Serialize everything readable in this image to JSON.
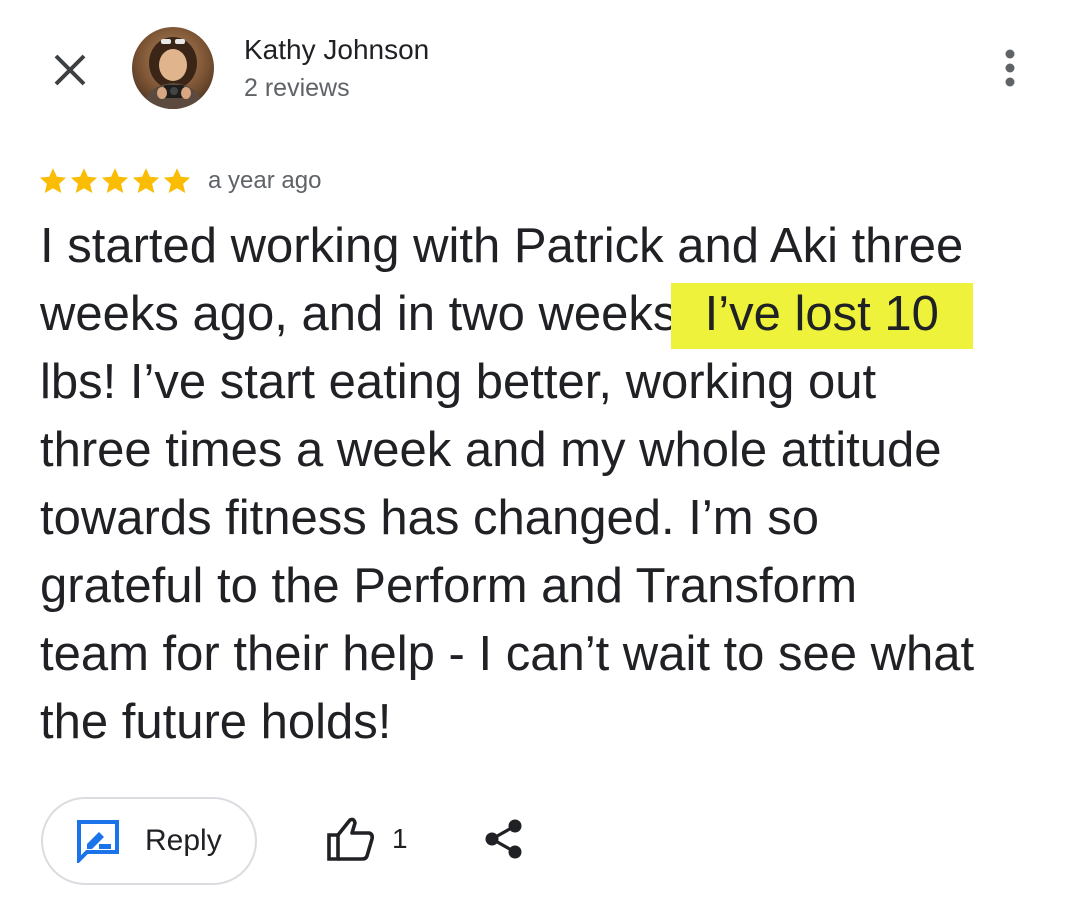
{
  "header": {
    "close_icon": "close-icon",
    "author_name": "Kathy Johnson",
    "author_reviews": "2 reviews",
    "more_icon": "more-vert-icon"
  },
  "review": {
    "stars": 5,
    "max_stars": 5,
    "star_color": "#fbbc04",
    "date": "a year ago",
    "lines": [
      "I started working with Patrick and Aki three",
      "weeks ago, and in two weeks,",
      "lbs! I’ve start eating better, working out",
      "three times a week and my whole attitude",
      "towards fitness has changed. I’m so",
      "grateful to the Perform and Transform",
      "team for their help - I can’t wait to see what",
      "the future holds!"
    ],
    "highlighted_text": " I’ve lost 10",
    "highlight_color": "#eef23a"
  },
  "actions": {
    "reply_label": "Reply",
    "reply_icon": "rate-review-icon",
    "reply_icon_color": "#1a73e8",
    "like_icon": "thumb-up-icon",
    "like_count": "1",
    "share_icon": "share-icon"
  }
}
